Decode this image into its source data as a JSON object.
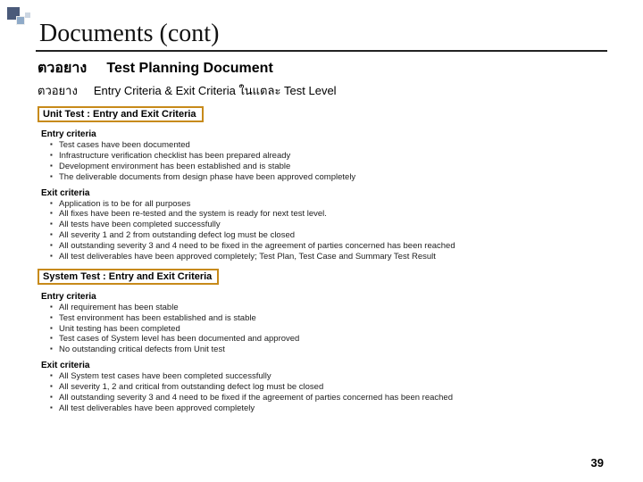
{
  "title": "Documents (cont)",
  "line1_label": "ตวอยาง",
  "line1_text": "Test Planning Document",
  "line2_label": "ตวอยาง",
  "line2_text": "Entry Criteria & Exit Criteria ในแตละ  Test Level",
  "box1": "Unit Test : Entry and Exit Criteria",
  "sec1": {
    "title": "Entry criteria",
    "items": [
      "Test cases have been documented",
      "Infrastructure verification checklist has been prepared already",
      "Development environment has been established and is stable",
      "The deliverable documents from design phase have been approved completely"
    ]
  },
  "sec2": {
    "title": "Exit criteria",
    "items": [
      "Application is to be for all purposes",
      "All fixes have been re-tested and the system is ready for next test level.",
      "All tests have been completed successfully",
      "All severity 1 and 2 from outstanding defect log must be closed",
      "All outstanding severity 3 and 4 need to be fixed in the agreement of parties concerned has been reached",
      "All test deliverables have been approved completely; Test Plan, Test Case and Summary Test Result"
    ]
  },
  "box2": "System Test : Entry and Exit Criteria",
  "sec3": {
    "title": "Entry criteria",
    "items": [
      "All requirement has been stable",
      "Test environment has been established and is stable",
      "Unit testing has been completed",
      "Test cases of System level has been documented and approved",
      "No outstanding critical defects from Unit test"
    ]
  },
  "sec4": {
    "title": "Exit criteria",
    "items": [
      "All System test cases have been completed successfully",
      "All severity 1, 2 and critical from outstanding defect log must be closed",
      "All outstanding severity 3 and 4 need to be fixed if the agreement of parties concerned has been reached",
      "All test deliverables have been approved completely"
    ]
  },
  "page_number": "39"
}
